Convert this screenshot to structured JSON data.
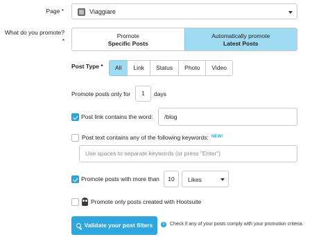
{
  "page_field": {
    "label": "Page *",
    "value": "Viaggiare"
  },
  "promote_field": {
    "label_line1": "What do you promote?",
    "label_line2": "*",
    "options": [
      {
        "line1": "Promote",
        "line2": "Specific Posts",
        "active": false
      },
      {
        "line1": "Automatically promote",
        "line2": "Latest Posts",
        "active": true
      }
    ]
  },
  "post_type": {
    "label": "Post Type *",
    "options": [
      "All",
      "Link",
      "Status",
      "Photo",
      "Video"
    ],
    "selected": "All"
  },
  "promote_only_for": {
    "prefix": "Promote posts only for",
    "value": "1",
    "suffix": "days"
  },
  "link_contains": {
    "checked": true,
    "label": "Post link contains the word:",
    "value": "/blog"
  },
  "text_contains": {
    "checked": false,
    "label": "Post text contains any of the following keywords:",
    "badge": "NEW!",
    "placeholder": "Use spaces to separate keywords (or press \"Enter\")"
  },
  "more_than": {
    "checked": true,
    "label": "Promote posts with more than",
    "value": "10",
    "metric": "Likes"
  },
  "hootsuite_only": {
    "checked": false,
    "label": "Promote only posts created with Hootsuite"
  },
  "validate": {
    "button_label": "Validate your post filters",
    "hint": "Check if any of your posts comply with your promotion criteria."
  },
  "colors": {
    "accent": "#2ea7e0",
    "active_segment": "#9fdcf3",
    "border": "#c9c9c9"
  }
}
